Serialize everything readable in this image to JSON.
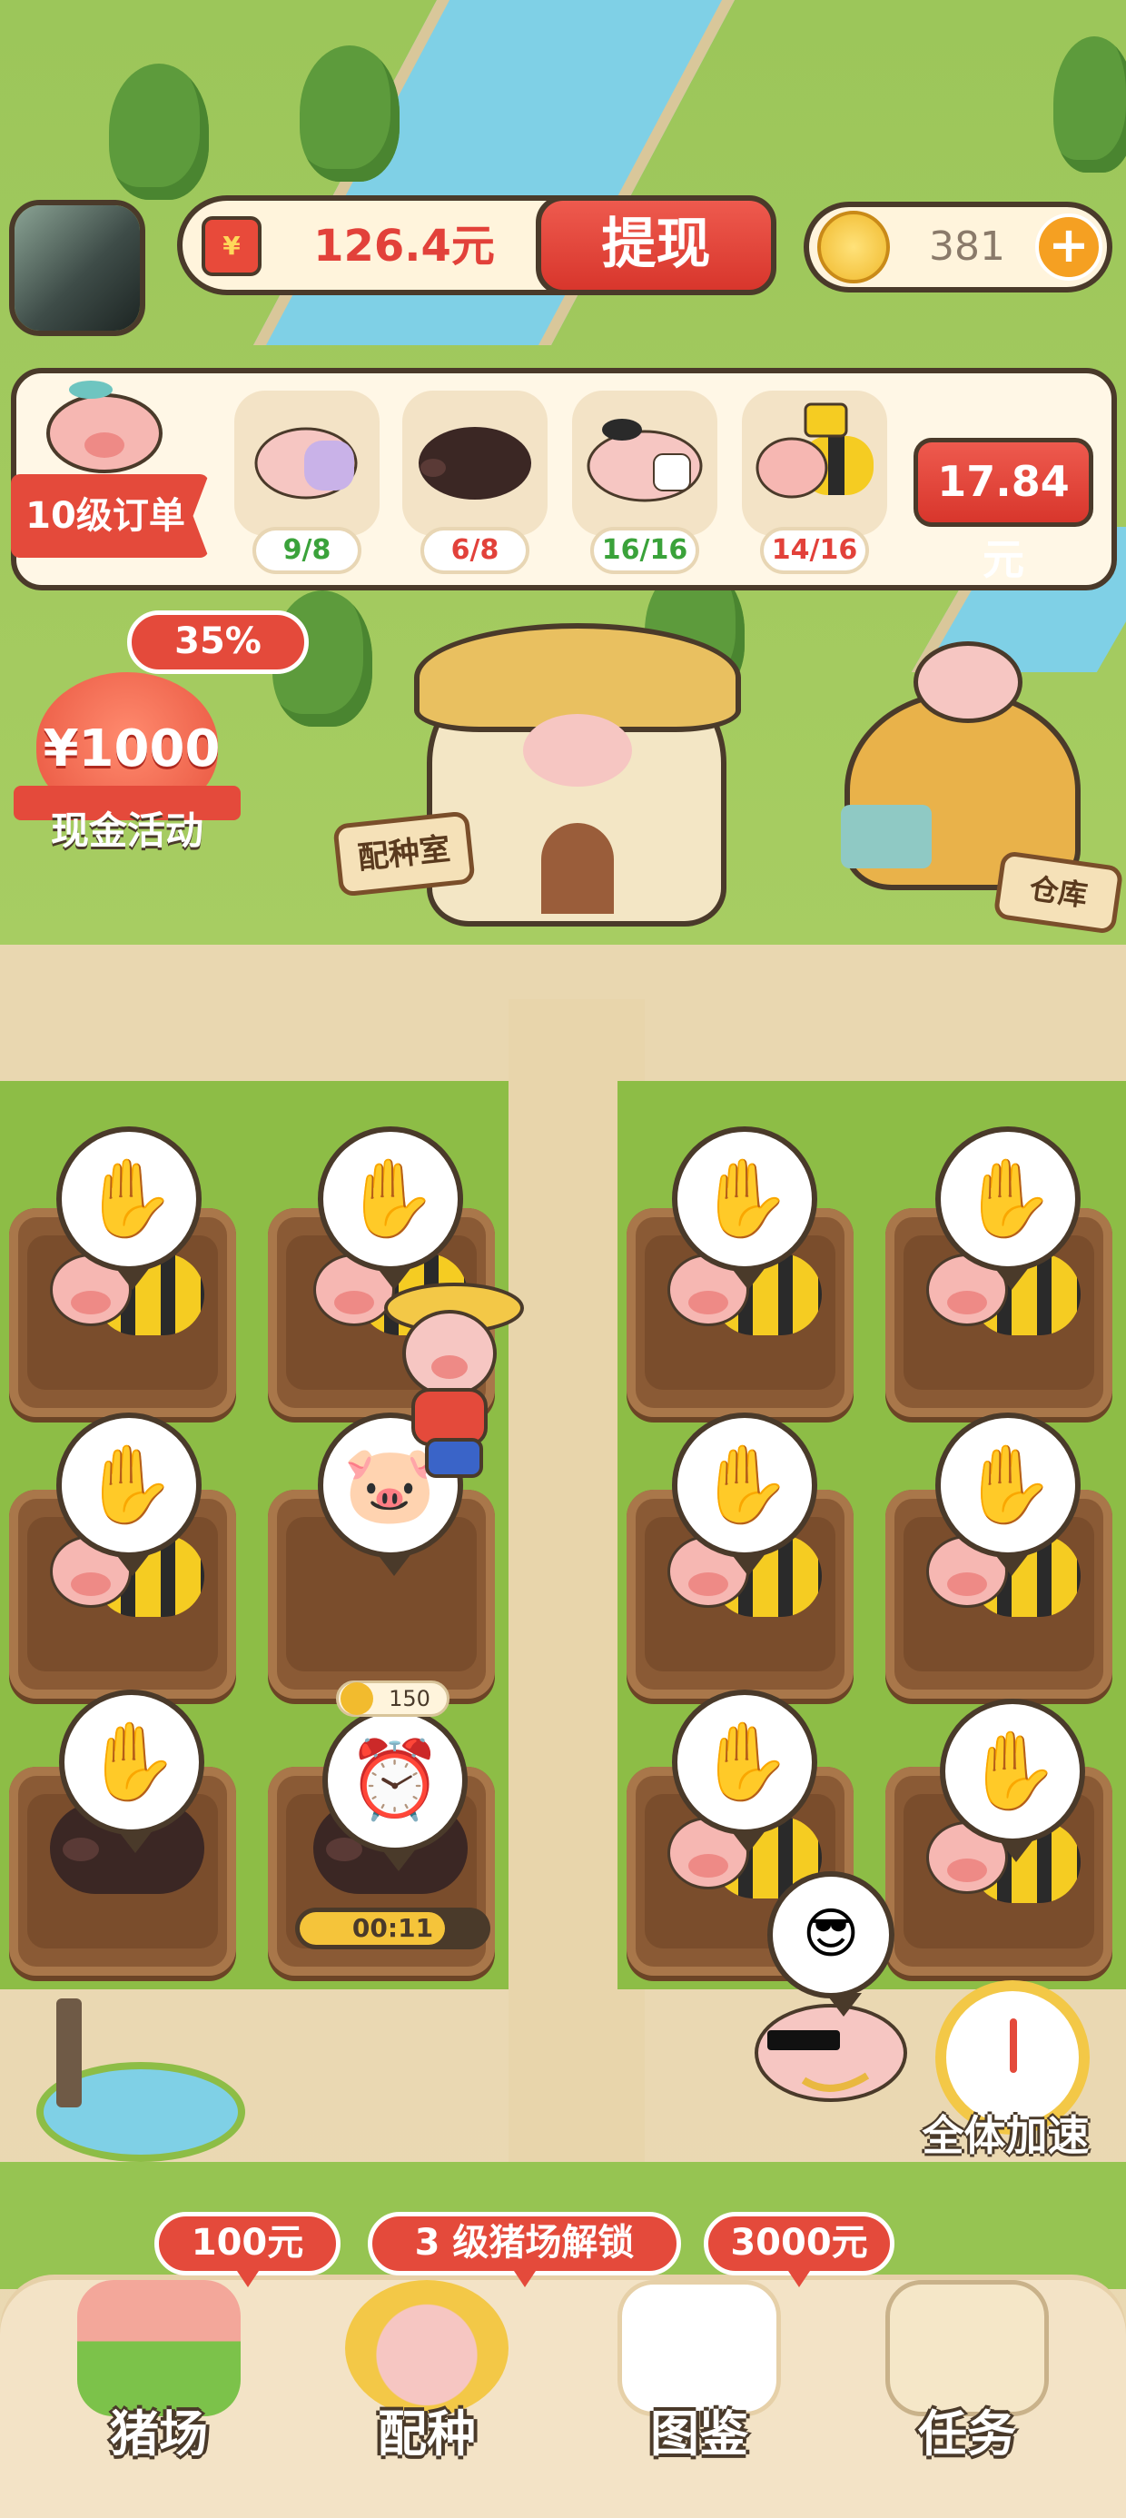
{
  "header": {
    "cash_icon": "¥",
    "cash_amount": "126.4元",
    "withdraw_label": "提现",
    "coins": "381",
    "plus_icon": "+"
  },
  "order": {
    "label": "10级订单",
    "slots": [
      {
        "pig": "purple-overalls-pig-icon",
        "count": "9/8"
      },
      {
        "pig": "black-pig-icon",
        "count": "6/8"
      },
      {
        "pig": "sumo-pig-icon",
        "count": "16/16"
      },
      {
        "pig": "bee-pig-icon",
        "count": "14/16"
      }
    ],
    "reward": "17.84元"
  },
  "activity": {
    "badge": "35%",
    "amount": "¥1000",
    "label": "现金活动"
  },
  "buildings": {
    "breeding_room": "配种室",
    "warehouse": "仓库"
  },
  "pens": {
    "timer": "00:11",
    "cost": "150"
  },
  "speed_up": {
    "label": "全体加速"
  },
  "nav": {
    "items": [
      {
        "label": "猪场",
        "badge": "100元"
      },
      {
        "label": "配种",
        "badge": "3 级猪场解锁"
      },
      {
        "label": "图鉴",
        "badge": "3000元"
      },
      {
        "label": "任务",
        "badge": ""
      }
    ]
  },
  "colors": {
    "accent_red": "#e44a3b",
    "gold": "#f5c43a",
    "outline": "#4a3a2a"
  }
}
